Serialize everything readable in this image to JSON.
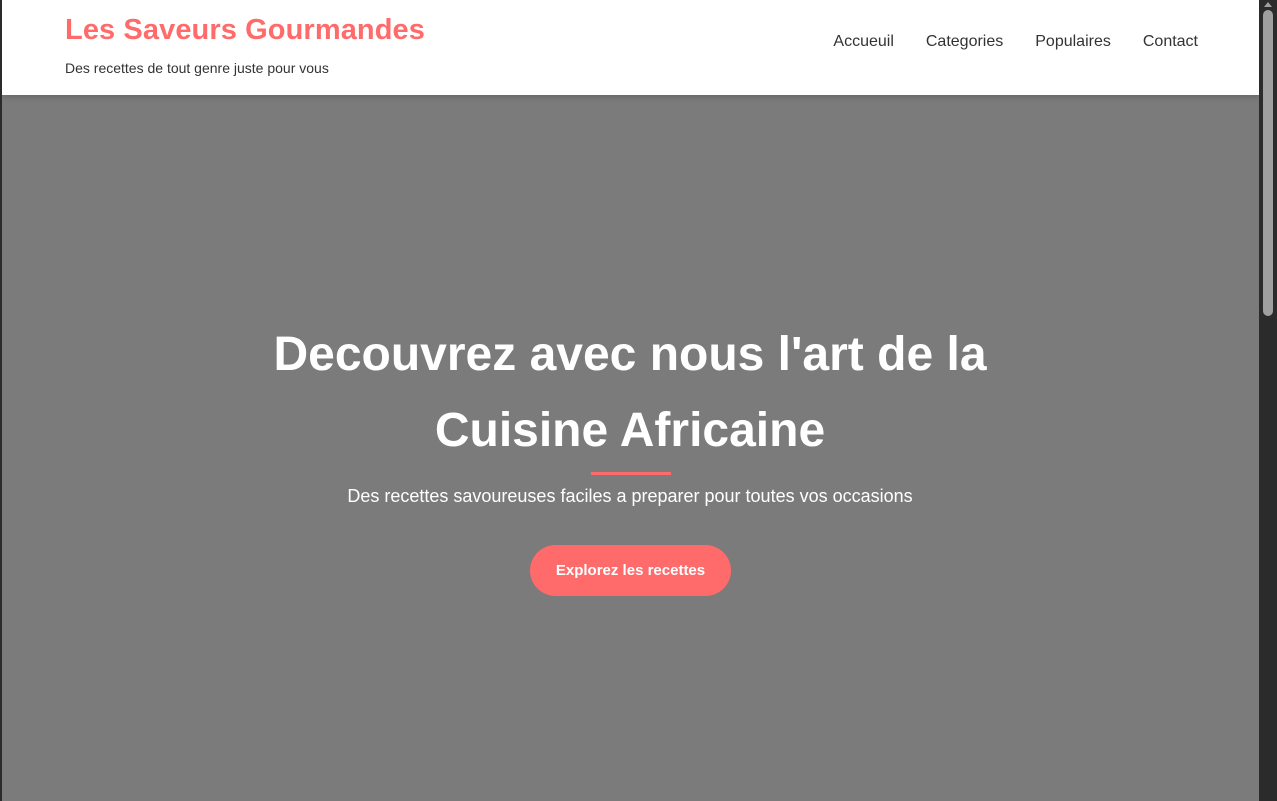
{
  "header": {
    "brand_title": "Les Saveurs Gourmandes",
    "tagline": "Des recettes de tout genre juste pour vous",
    "nav": [
      {
        "label": "Accueuil"
      },
      {
        "label": "Categories"
      },
      {
        "label": "Populaires"
      },
      {
        "label": "Contact"
      }
    ]
  },
  "hero": {
    "title": "Decouvrez avec nous l'art de la Cuisine Africaine",
    "subtitle": "Des recettes savoureuses faciles a preparer pour toutes vos occasions",
    "cta_label": "Explorez les recettes"
  },
  "colors": {
    "accent": "#ff6b6b",
    "hero_background": "#7b7b7b",
    "header_background": "#ffffff",
    "text_dark": "#333333"
  }
}
